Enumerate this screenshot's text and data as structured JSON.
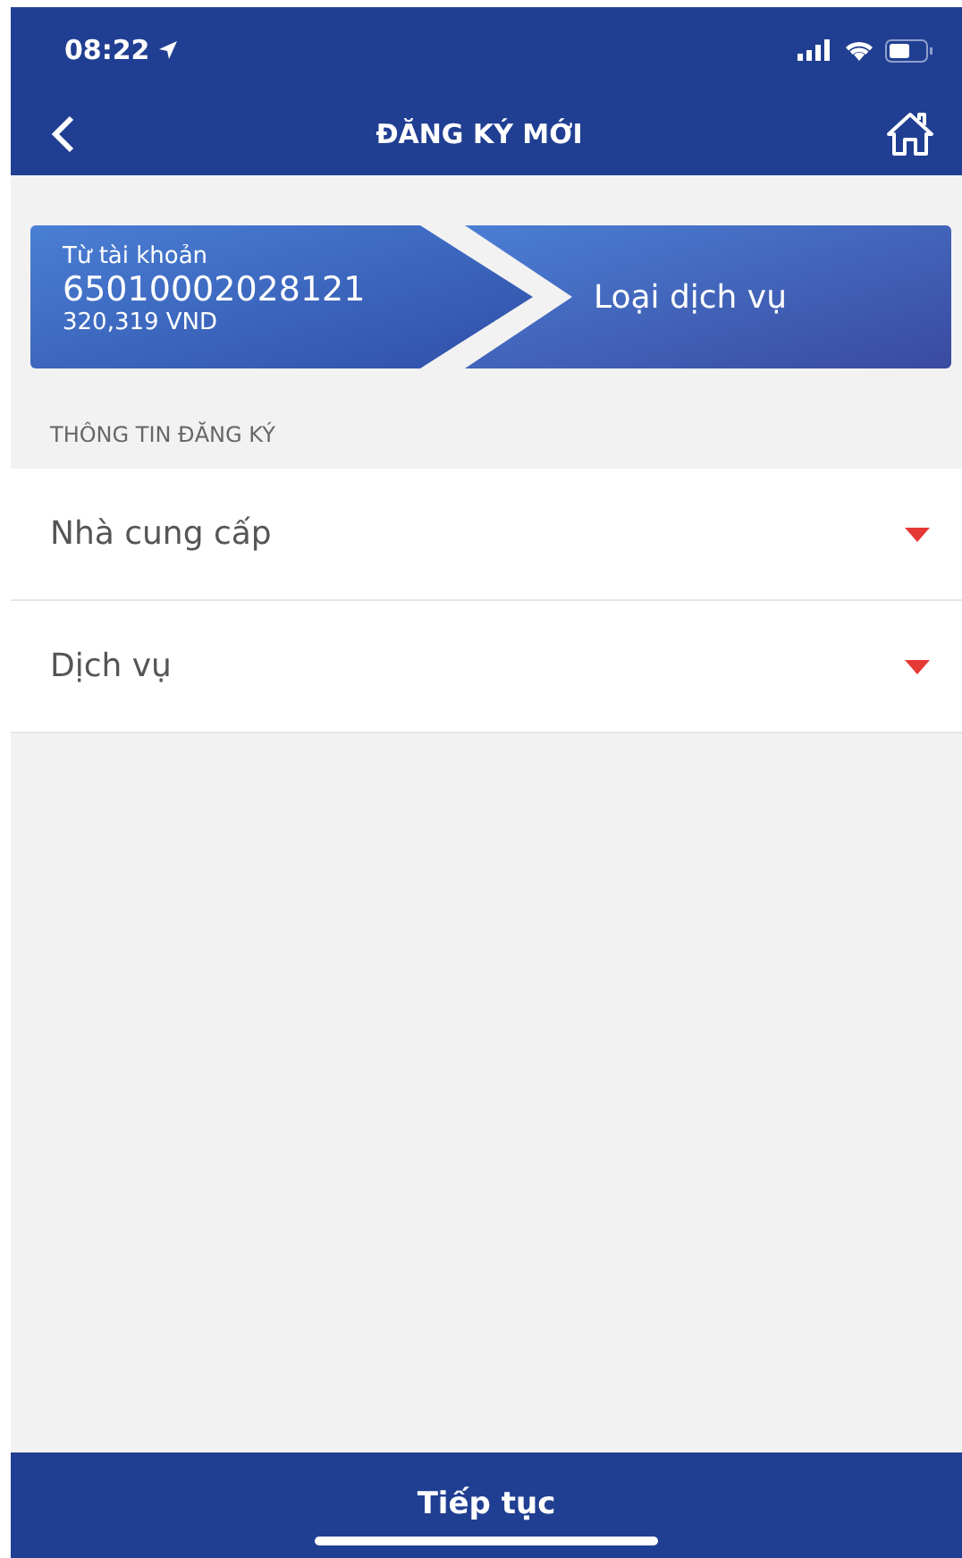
{
  "status_bar": {
    "time": "08:22"
  },
  "header": {
    "title": "ĐĂNG KÝ MỚI"
  },
  "account_step": {
    "label": "Từ tài khoản",
    "account": "65010002028121",
    "balance": "320,319 VND"
  },
  "service_step": {
    "label": "Loại dịch vụ"
  },
  "section_title": "THÔNG TIN ĐĂNG KÝ",
  "fields": [
    {
      "label": "Nhà cung cấp"
    },
    {
      "label": "Dịch vụ"
    }
  ],
  "continue_button": "Tiếp tục"
}
